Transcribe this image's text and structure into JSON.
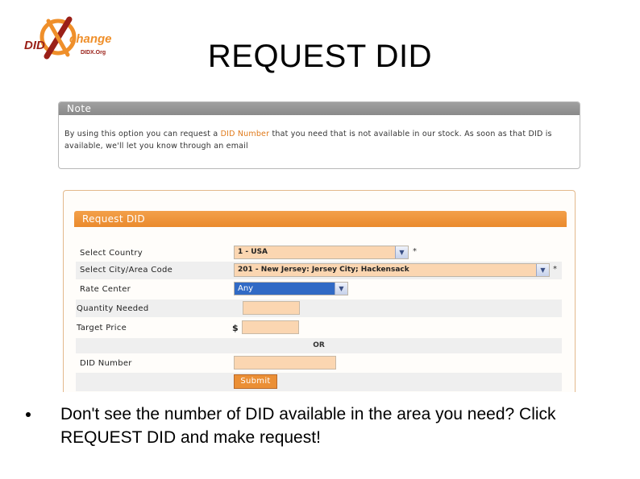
{
  "logo": {
    "name": "DIDXchange",
    "brand_left": "DID",
    "brand_right": "change",
    "url_text": "DIDX.Org"
  },
  "slide": {
    "title": "REQUEST DID"
  },
  "note": {
    "header": "Note",
    "text_before": "By using this option you can request a ",
    "text_highlight": "DID Number",
    "text_after": " that you need that is not available in our stock. As soon as that DID is available, we'll let you know through an email"
  },
  "request_form": {
    "header": "Request DID",
    "select_country_label": "Select Country",
    "select_country_value": "1 - USA",
    "select_area_label": "Select City/Area Code",
    "select_area_value": "201 - New Jersey: Jersey City; Hackensack",
    "rate_center_label": "Rate Center",
    "rate_center_value": "Any",
    "quantity_label": "Quantity Needed",
    "target_price_label": "Target Price",
    "currency_symbol": "$",
    "or_label": "OR",
    "did_number_label": "DID Number",
    "submit_label": "Submit",
    "required_mark": "*"
  },
  "bullet": {
    "text": "Don't see the number of DID available in the area you need? Click REQUEST DID and make request!"
  },
  "colors": {
    "accent": "#EA8A2D",
    "field": "#FBD6B1",
    "note_header": "#999999",
    "select_highlight": "#316AC5"
  }
}
